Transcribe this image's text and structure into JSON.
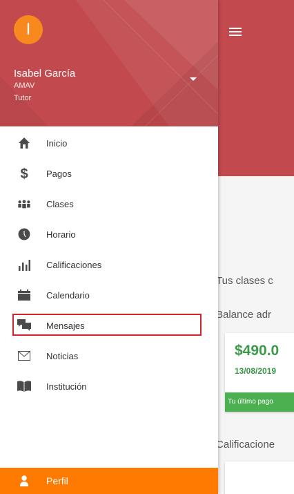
{
  "colors": {
    "header_red": "#c24a4f",
    "avatar_orange": "#f7891e",
    "profile_orange": "#ff7a00",
    "success_green": "#3a9a4a",
    "highlight_border": "#d2262e"
  },
  "drawer": {
    "avatar_initial": "I",
    "user_name": "Isabel García",
    "institution": "AMAV",
    "role": "Tutor",
    "menu": [
      {
        "label": "Inicio",
        "icon": "home-icon"
      },
      {
        "label": "Pagos",
        "icon": "dollar-icon"
      },
      {
        "label": "Clases",
        "icon": "people-icon"
      },
      {
        "label": "Horario",
        "icon": "clock-icon"
      },
      {
        "label": "Calificaciones",
        "icon": "bar-chart-icon"
      },
      {
        "label": "Calendario",
        "icon": "calendar-icon"
      },
      {
        "label": "Mensajes",
        "icon": "chat-icon",
        "highlighted": true
      },
      {
        "label": "Noticias",
        "icon": "mail-icon"
      },
      {
        "label": "Institución",
        "icon": "book-icon"
      }
    ],
    "profile_label": "Perfil"
  },
  "main": {
    "clases_text": "Tus clases c",
    "balance_text": "Balance adr",
    "card_amount": "$490.0",
    "card_date": "13/08/2019",
    "card_banner": "Tu último pago",
    "calificaciones_text": "Calificacione"
  }
}
